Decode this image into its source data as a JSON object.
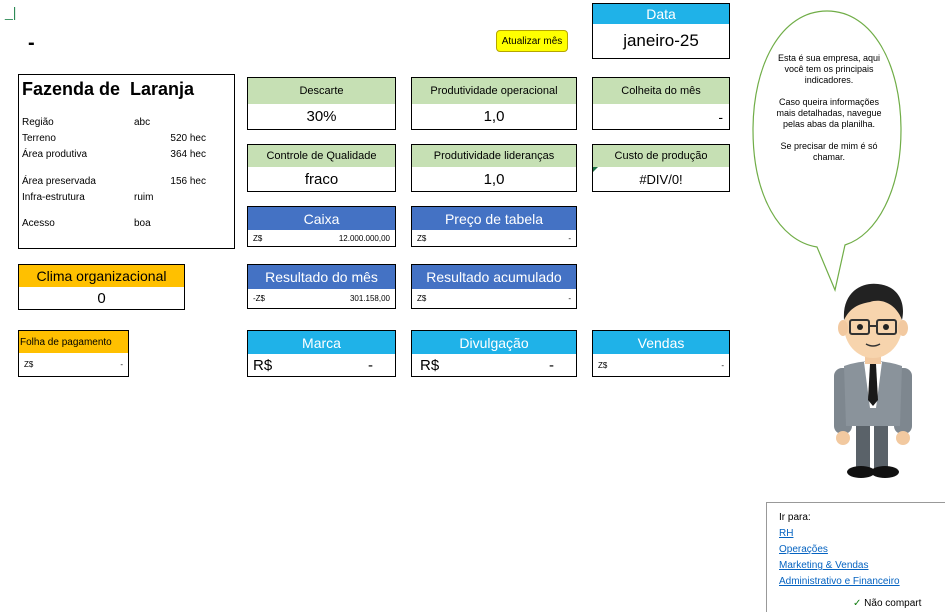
{
  "cell_marker": "_|",
  "top_dash": "-",
  "update_button": "Atualizar mês",
  "date": {
    "label": "Data",
    "value": "janeiro-25"
  },
  "farm": {
    "title": "Fazenda de  Laranja",
    "rows": [
      {
        "label": "Região",
        "value": "abc"
      },
      {
        "label": "Terreno",
        "value": "520 hec"
      },
      {
        "label": "Área produtiva",
        "value": "364 hec"
      },
      {
        "label": "Área preservada",
        "value": "156 hec"
      },
      {
        "label": "Infra-estrutura",
        "value": "ruim"
      },
      {
        "label": "Acesso",
        "value": "boa"
      }
    ]
  },
  "climate": {
    "label": "Clima organizacional",
    "value": "0"
  },
  "payroll": {
    "label": "Folha de pagamento",
    "currency": "Z$",
    "value": "-"
  },
  "kpis": {
    "descarte": {
      "label": "Descarte",
      "value": "30%"
    },
    "prod_operacional": {
      "label": "Produtividade operacional",
      "value": "1,0"
    },
    "colheita": {
      "label": "Colheita do mês",
      "value": "-"
    },
    "controle": {
      "label": "Controle de Qualidade",
      "value": "fraco"
    },
    "prod_liderancas": {
      "label": "Produtividade lideranças",
      "value": "1,0"
    },
    "custo": {
      "label": "Custo de produção",
      "value": "#DIV/0!"
    }
  },
  "finance": {
    "caixa": {
      "label": "Caixa",
      "currency": "Z$",
      "value": "12.000.000,00"
    },
    "preco": {
      "label": "Preço de tabela",
      "currency": "Z$",
      "value": "-"
    },
    "resultado_mes": {
      "label": "Resultado do mês",
      "currency": "-Z$",
      "value": "301.158,00"
    },
    "resultado_acum": {
      "label": "Resultado acumulado",
      "currency": "Z$",
      "value": "-"
    }
  },
  "marketing": {
    "marca": {
      "label": "Marca",
      "currency": "R$",
      "value": "-"
    },
    "divulgacao": {
      "label": "Divulgação",
      "currency": "R$",
      "value": "-"
    },
    "vendas": {
      "label": "Vendas",
      "currency": "Z$",
      "value": "-"
    }
  },
  "speech": {
    "p1": "Esta é sua empresa, aqui você tem os principais indicadores.",
    "p2": "Caso queira informações mais detalhadas, navegue pelas abas da planilha.",
    "p3": "Se precisar de mim é só chamar."
  },
  "nav": {
    "title": "Ir para:",
    "links": [
      "RH",
      "Operações",
      "Marketing & Vendas",
      "Administrativo e Financeiro"
    ]
  },
  "status": "Não compart",
  "colors": {
    "green_header": "#c6e0b4",
    "blue_header": "#4472c4",
    "cyan_header": "#1fb2e8",
    "orange_header": "#ffc000",
    "button_yellow": "#ffff00"
  }
}
